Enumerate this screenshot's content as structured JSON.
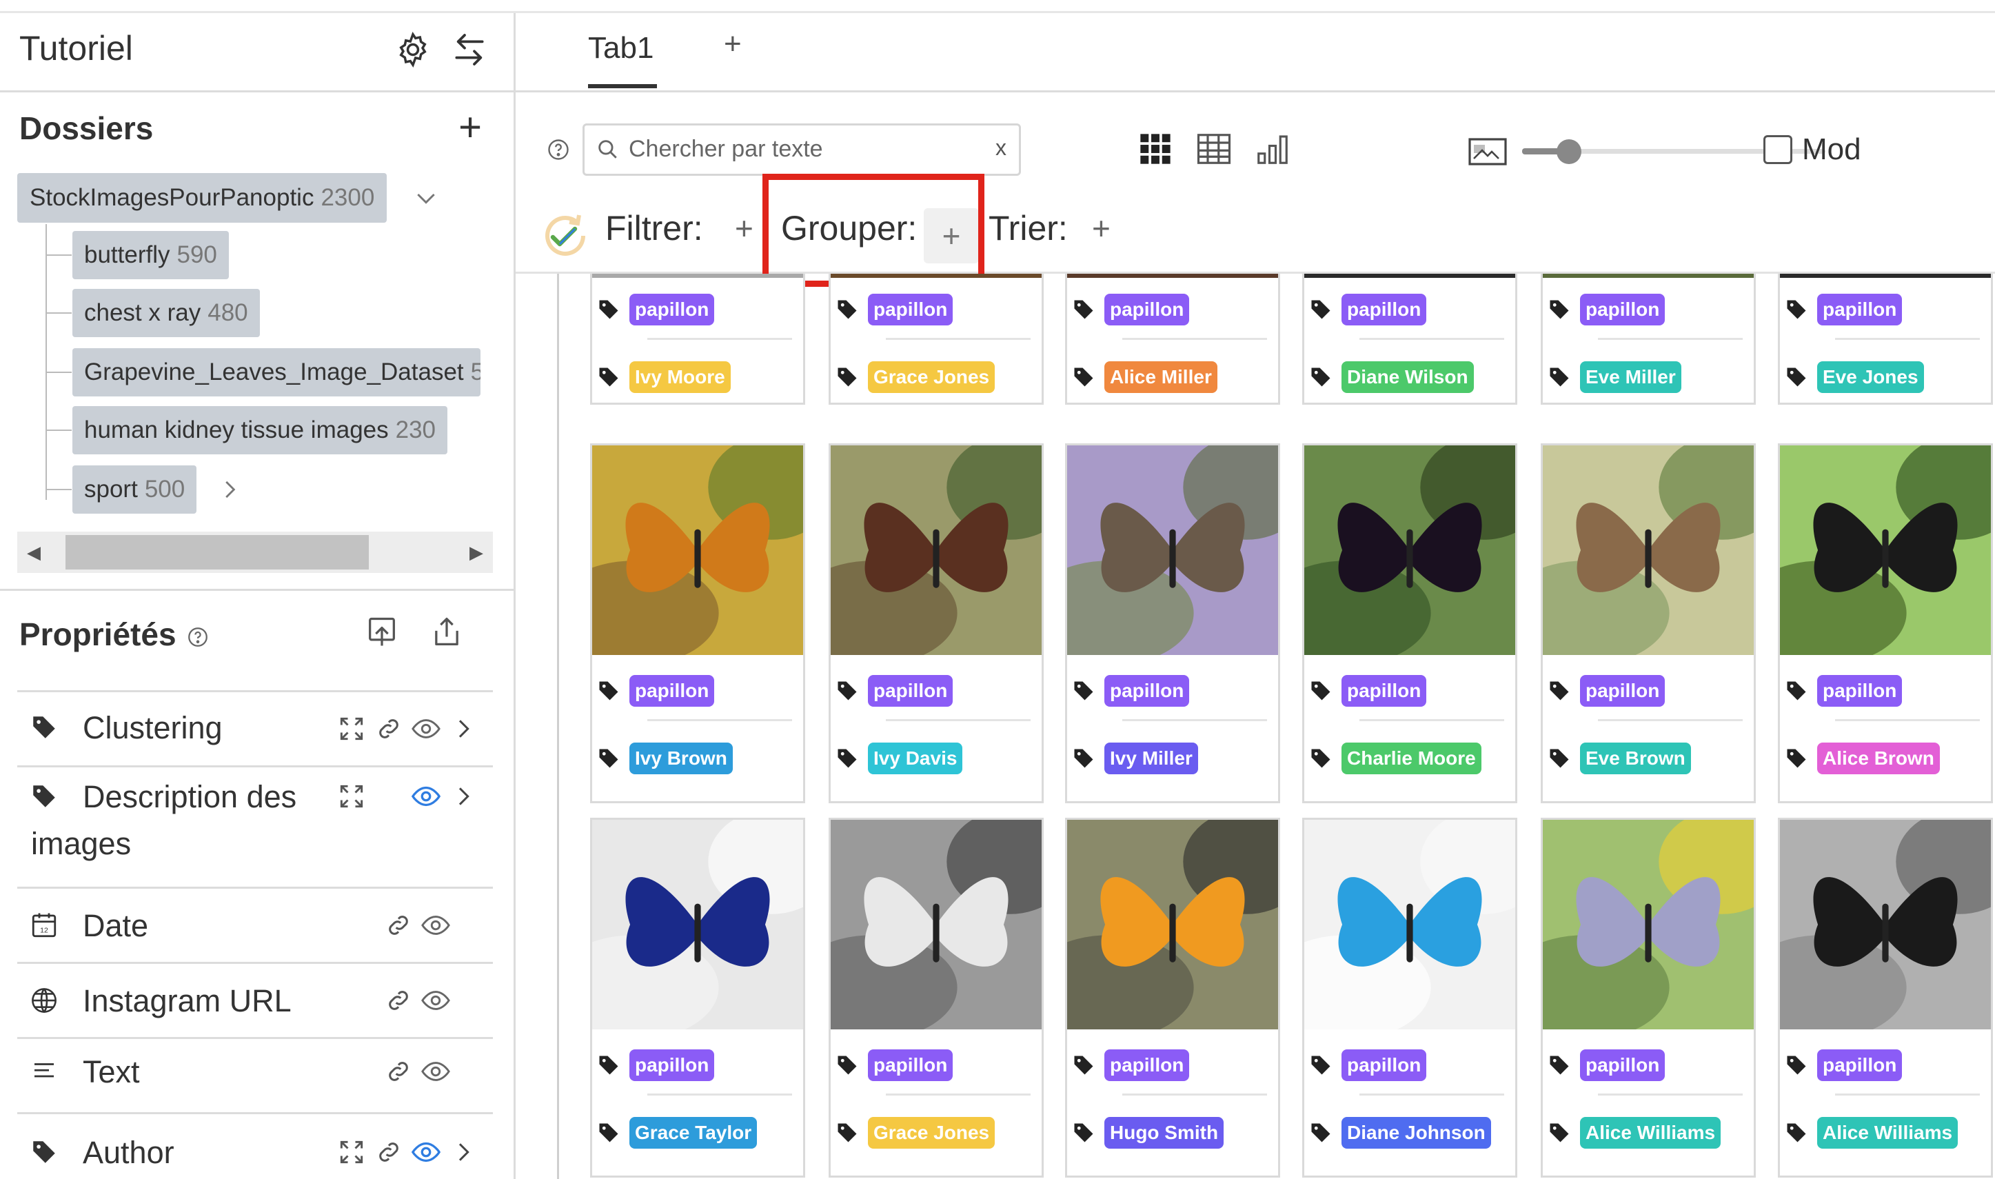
{
  "app": {
    "title": "Tutoriel"
  },
  "folders": {
    "title": "Dossiers",
    "root": {
      "name": "StockImagesPourPanoptic",
      "count": "2300"
    },
    "children": [
      {
        "name": "butterfly",
        "count": "590"
      },
      {
        "name": "chest x ray",
        "count": "480"
      },
      {
        "name": "Grapevine_Leaves_Image_Dataset",
        "count": "5"
      },
      {
        "name": "human kidney tissue images",
        "count": "230"
      },
      {
        "name": "sport",
        "count": "500"
      }
    ]
  },
  "properties": {
    "title": "Propriétés",
    "items": [
      {
        "label": "Clustering",
        "icon": "tag-icon"
      },
      {
        "label": "Description des images",
        "icon": "tag-icon"
      },
      {
        "label": "Date",
        "icon": "calendar-icon"
      },
      {
        "label": "Instagram URL",
        "icon": "globe-icon"
      },
      {
        "label": "Text",
        "icon": "text-lines-icon"
      },
      {
        "label": "Author",
        "icon": "tag-icon"
      }
    ]
  },
  "tabs": [
    {
      "label": "Tab1"
    }
  ],
  "toolbar": {
    "search_placeholder": "Chercher par texte",
    "filter_label": "Filtrer:",
    "group_label": "Grouper:",
    "sort_label": "Trier:",
    "mode_label": "Mod"
  },
  "colors": {
    "accent_highlight": "#e0241b",
    "badge_purple": "#8b5cf6",
    "badge_yellow": "#f5c842",
    "badge_orange": "#f0883e",
    "badge_green": "#4cc96a",
    "badge_teal": "#2ec4b6",
    "badge_blue": "#2d9cdb",
    "badge_indigo": "#4f6cf0",
    "badge_pink": "#e35fd6"
  },
  "gallery": {
    "rows": [
      [
        {
          "tag1": "papillon",
          "tag2": "Ivy Moore",
          "color2": "#f5c842"
        },
        {
          "tag1": "papillon",
          "tag2": "Grace Jones",
          "color2": "#f5c842"
        },
        {
          "tag1": "papillon",
          "tag2": "Alice Miller",
          "color2": "#f0883e"
        },
        {
          "tag1": "papillon",
          "tag2": "Diane Wilson",
          "color2": "#4cc96a"
        },
        {
          "tag1": "papillon",
          "tag2": "Eve Miller",
          "color2": "#2ec4b6"
        },
        {
          "tag1": "papillon",
          "tag2": "Eve Jones",
          "color2": "#2ec4b6"
        }
      ],
      [
        {
          "tag1": "papillon",
          "tag2": "Ivy Brown",
          "color2": "#2d9cdb"
        },
        {
          "tag1": "papillon",
          "tag2": "Ivy Davis",
          "color2": "#2ec4d6"
        },
        {
          "tag1": "papillon",
          "tag2": "Ivy Miller",
          "color2": "#6a5cf0"
        },
        {
          "tag1": "papillon",
          "tag2": "Charlie Moore",
          "color2": "#4cc96a"
        },
        {
          "tag1": "papillon",
          "tag2": "Eve Brown",
          "color2": "#2ec4b6"
        },
        {
          "tag1": "papillon",
          "tag2": "Alice Brown",
          "color2": "#e35fd6"
        }
      ],
      [
        {
          "tag1": "papillon",
          "tag2": "Grace Taylor",
          "color2": "#2d9cdb"
        },
        {
          "tag1": "papillon",
          "tag2": "Grace Jones",
          "color2": "#f5c842"
        },
        {
          "tag1": "papillon",
          "tag2": "Hugo Smith",
          "color2": "#6a5cf0"
        },
        {
          "tag1": "papillon",
          "tag2": "Diane Johnson",
          "color2": "#4f6cf0"
        },
        {
          "tag1": "papillon",
          "tag2": "Alice Williams",
          "color2": "#2ec4b6"
        },
        {
          "tag1": "papillon",
          "tag2": "Alice Williams",
          "color2": "#2ec4b6"
        }
      ]
    ]
  }
}
